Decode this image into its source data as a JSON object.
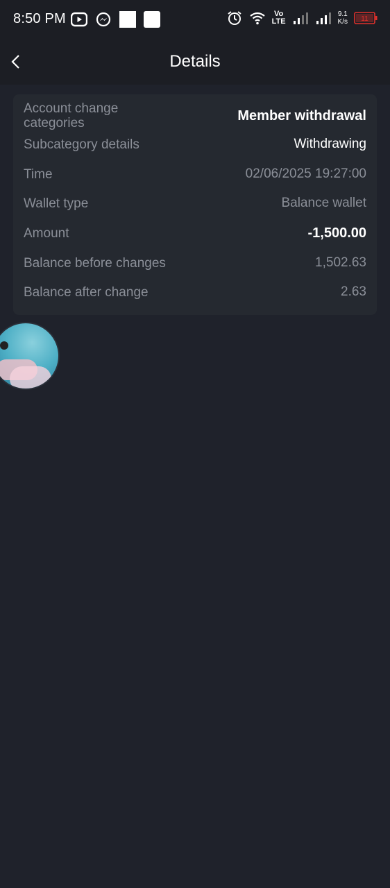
{
  "status_bar": {
    "time": "8:50 PM",
    "volte_top": "Vo",
    "volte_bottom": "LTE",
    "speed_value": "9.1",
    "speed_unit": "K/s",
    "battery_level": "11",
    "icons": [
      "youtube-icon",
      "messenger-icon",
      "white-square-icon",
      "white-square-icon",
      "alarm-icon",
      "wifi-icon",
      "signal-icon",
      "signal-icon",
      "battery-icon"
    ]
  },
  "header": {
    "title": "Details"
  },
  "details": {
    "rows": [
      {
        "label": "Account change categories",
        "value": "Member withdrawal"
      },
      {
        "label": "Subcategory details",
        "value": "Withdrawing"
      },
      {
        "label": "Time",
        "value": "02/06/2025 19:27:00"
      },
      {
        "label": "Wallet type",
        "value": "Balance wallet"
      },
      {
        "label": "Amount",
        "value": "-1,500.00"
      },
      {
        "label": "Balance before changes",
        "value": "1,502.63"
      },
      {
        "label": "Balance after change",
        "value": "2.63"
      }
    ]
  },
  "colors": {
    "background": "#1f222b",
    "card": "#252930",
    "label": "#8b8f98",
    "value_strong": "#ffffff",
    "battery": "#e0312c"
  }
}
